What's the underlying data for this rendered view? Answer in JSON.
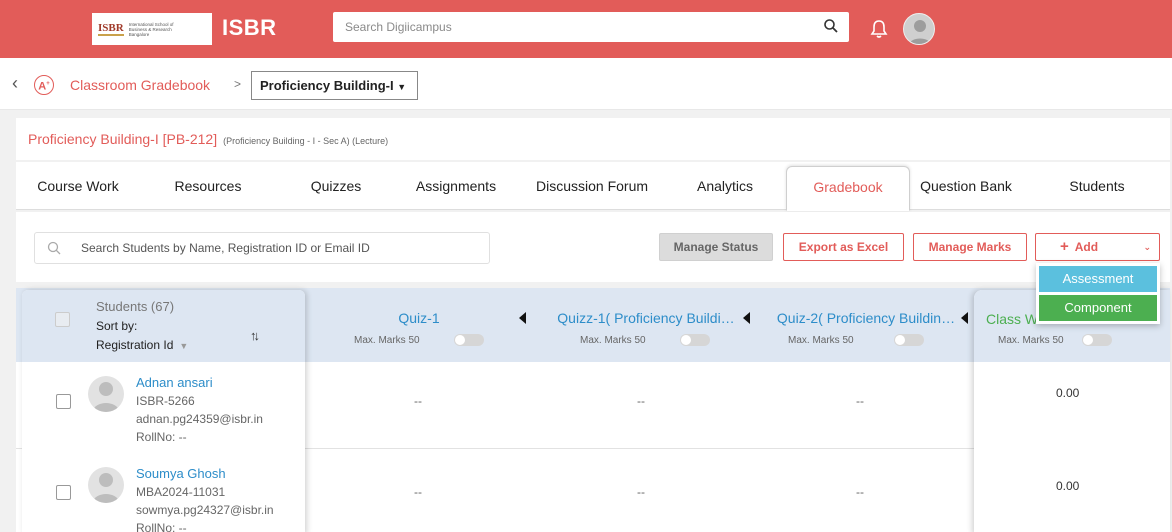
{
  "topbar": {
    "logo_text": "ISBR",
    "logo_subtext": "International School of Business & Research Bangalore",
    "brand": "ISBR",
    "search_placeholder": "Search Digiicampus"
  },
  "breadcrumb": {
    "link": "Classroom Gradebook",
    "separator": ">",
    "current": "Proficiency Building-I"
  },
  "course": {
    "title": "Proficiency Building-I [PB-212]",
    "subtitle": "(Proficiency Building - I - Sec A) (Lecture)"
  },
  "tabs": [
    "Course Work",
    "Resources",
    "Quizzes",
    "Assignments",
    "Discussion Forum",
    "Analytics",
    "Gradebook",
    "Question Bank",
    "Students"
  ],
  "active_tab": "Gradebook",
  "toolbar": {
    "search_placeholder": "Search Students by Name, Registration ID or Email ID",
    "manage_status": "Manage Status",
    "export_excel": "Export as Excel",
    "manage_marks": "Manage Marks",
    "add": "Add",
    "add_menu": [
      "Assessment",
      "Component"
    ]
  },
  "grid": {
    "students_count": "Students (67)",
    "sort_by_label": "Sort by:",
    "sort_by_value": "Registration Id",
    "columns": [
      {
        "title": "Quiz-1",
        "meta": "Max. Marks 50"
      },
      {
        "title": "Quizz-1( Proficiency Buildi…",
        "meta": "Max. Marks 50"
      },
      {
        "title": "Quiz-2( Proficiency Buildin…",
        "meta": "Max. Marks 50"
      },
      {
        "title": "Class W",
        "meta": "Max. Marks 50"
      }
    ],
    "rows": [
      {
        "name": "Adnan ansari",
        "reg": "ISBR-5266",
        "email": "adnan.pg24359@isbr.in",
        "roll": "RollNo: --",
        "cells": [
          "--",
          "--",
          "--"
        ],
        "class_w": "0.00"
      },
      {
        "name": "Soumya Ghosh",
        "reg": "MBA2024-11031",
        "email": "sowmya.pg24327@isbr.in",
        "roll": "RollNo: --",
        "cells": [
          "--",
          "--",
          "--"
        ],
        "class_w": "0.00"
      }
    ]
  },
  "colors": {
    "brand": "#e25c59",
    "link": "#2d8dc9",
    "assessment": "#5bc0de",
    "component": "#4caf50"
  }
}
